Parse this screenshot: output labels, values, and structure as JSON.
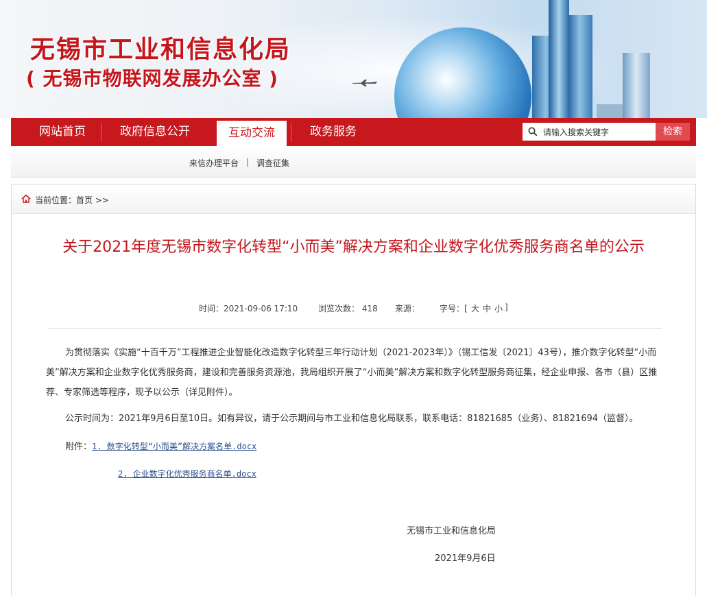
{
  "header": {
    "title": "无锡市工业和信息化局",
    "subtitle": "( 无锡市物联网发展办公室 )"
  },
  "nav": {
    "items": [
      {
        "label": "网站首页"
      },
      {
        "label": "政府信息公开"
      },
      {
        "label": "互动交流",
        "active": true
      },
      {
        "label": "政务服务"
      }
    ],
    "search_placeholder": "请输入搜索关键字",
    "search_button": "检索"
  },
  "subnav": {
    "items": [
      "来信办理平台",
      "调查征集"
    ],
    "separator": "|"
  },
  "breadcrumb": {
    "text": "当前位置：首页 >>"
  },
  "article": {
    "title": "关于2021年度无锡市数字化转型“小而美”解决方案和企业数字化优秀服务商名单的公示",
    "meta": {
      "time": "时间：2021-09-06 17:10",
      "views": "浏览次数： 418",
      "source": "来源：",
      "fontsize_label": "字号：[",
      "font_large": "大",
      "font_medium": "中",
      "font_small": "小",
      "fontsize_end": "]"
    },
    "paragraph1": "为贯彻落实《实施“十百千万”工程推进企业智能化改造数字化转型三年行动计划（2021-2023年）》（锡工信发〔2021〕43号），推介数字化转型“小而美”解决方案和企业数字化优秀服务商，建设和完善服务资源池，我局组织开展了“小而美”解决方案和数字化转型服务商征集，经企业申报、各市（县）区推荐、专家筛选等程序，现予以公示（详见附件）。",
    "paragraph2": "公示时间为：2021年9月6日至10日。如有异议，请于公示期间与市工业和信息化局联系，联系电话：81821685（业务）、81821694（监督）。",
    "attachments_label": "附件：",
    "attachment1": "1. 数字化转型“小而美”解决方案名单.docx",
    "attachment2": "2. 企业数字化优秀服务商名单.docx",
    "signature": "无锡市工业和信息化局",
    "date": "2021年9月6日"
  },
  "colors": {
    "brand_red": "#c7181e",
    "title_red": "#c4161c",
    "link_blue": "#2b4e8c"
  }
}
